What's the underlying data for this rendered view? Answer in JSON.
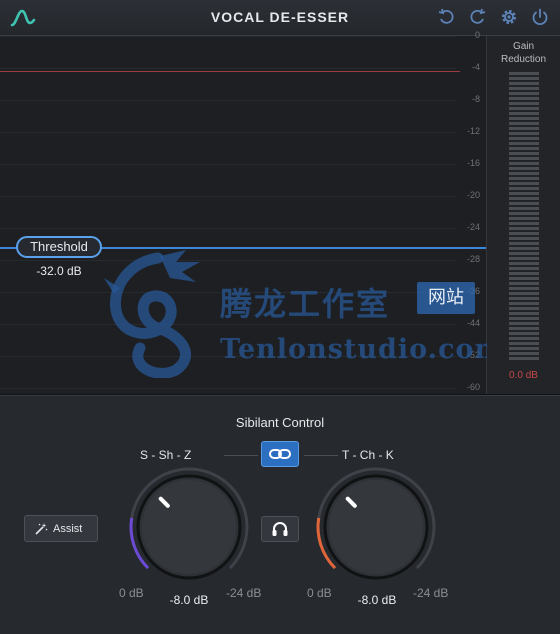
{
  "titlebar": {
    "title": "VOCAL DE-ESSER",
    "icons": [
      "logo-icon",
      "undo-icon",
      "redo-icon",
      "settings-gear-icon",
      "power-icon"
    ]
  },
  "graph": {
    "ticks": [
      "0",
      "-4",
      "-8",
      "-12",
      "-16",
      "-20",
      "-24",
      "-28",
      "-36",
      "-44",
      "-52",
      "-60"
    ],
    "threshold_label": "Threshold",
    "threshold_value": "-32.0 dB",
    "colors": {
      "threshold": "#3c86d8",
      "ceiling": "#9b3c3e"
    }
  },
  "meter": {
    "title": "Gain Reduction",
    "value": "0.0 dB",
    "level_fraction": 0
  },
  "sibilant": {
    "title": "Sibilant Control",
    "left_band": "S - Sh - Z",
    "right_band": "T - Ch - K",
    "assist_label": "Assist",
    "left_knob": {
      "min": "0 dB",
      "max": "-24 dB",
      "value": "-8.0 dB",
      "accent": "#6b4ad6"
    },
    "right_knob": {
      "min": "0 dB",
      "max": "-24 dB",
      "value": "-8.0 dB",
      "accent": "#e0663a"
    }
  },
  "watermark": {
    "cn": "腾龙工作室",
    "tag": "网站",
    "en": "Tenlonstudio.com"
  }
}
